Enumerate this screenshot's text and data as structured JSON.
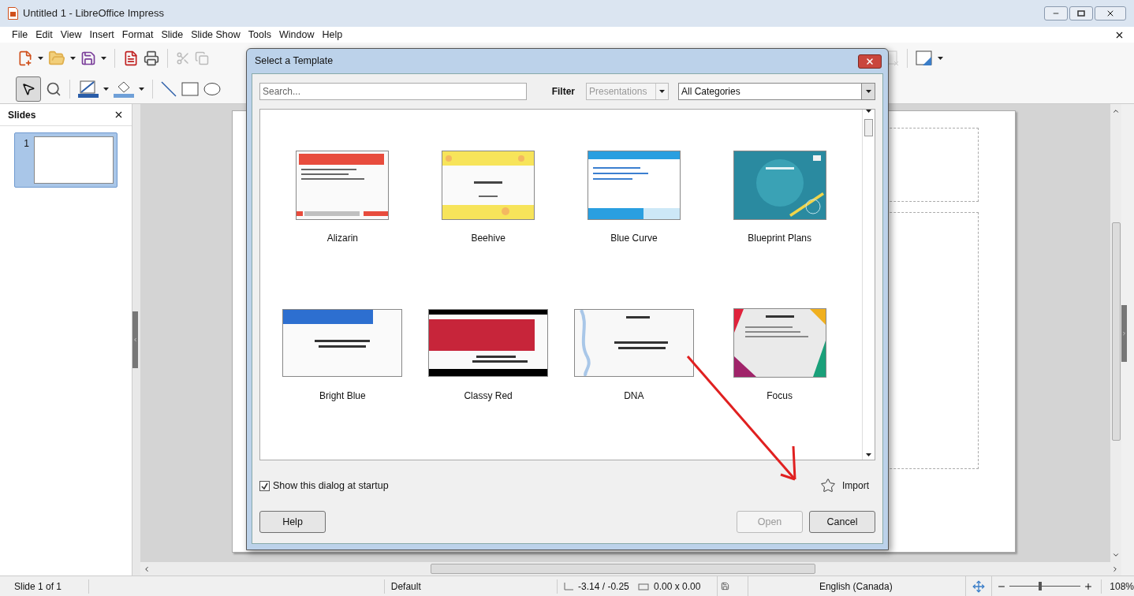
{
  "window": {
    "title": "Untitled 1 - LibreOffice Impress"
  },
  "menu": [
    "File",
    "Edit",
    "View",
    "Insert",
    "Format",
    "Slide",
    "Slide Show",
    "Tools",
    "Window",
    "Help"
  ],
  "slides_panel": {
    "title": "Slides",
    "slides": [
      {
        "number": "1",
        "selected": true
      }
    ]
  },
  "dialog": {
    "title": "Select a Template",
    "search": {
      "placeholder": "Search..."
    },
    "filter_label": "Filter",
    "filter_type": {
      "value": "Presentations",
      "disabled": true
    },
    "category": {
      "value": "All Categories"
    },
    "templates": [
      {
        "name": "Alizarin"
      },
      {
        "name": "Beehive"
      },
      {
        "name": "Blue Curve"
      },
      {
        "name": "Blueprint Plans"
      },
      {
        "name": "Bright Blue"
      },
      {
        "name": "Classy Red"
      },
      {
        "name": "DNA"
      },
      {
        "name": "Focus"
      }
    ],
    "show_at_startup": {
      "label": "Show this dialog at startup",
      "checked": true
    },
    "import": "Import",
    "buttons": [
      {
        "label": "Help",
        "disabled": false
      },
      {
        "label": "Open",
        "disabled": true
      },
      {
        "label": "Cancel",
        "disabled": false
      }
    ]
  },
  "status_bar": {
    "slide": "Slide 1 of 1",
    "layout": "Default",
    "position": "-3.14 / -0.25",
    "size": "0.00 x 0.00",
    "language": "English (Canada)",
    "zoom_slider": {
      "level": 0.43
    },
    "zoom": "108%"
  }
}
